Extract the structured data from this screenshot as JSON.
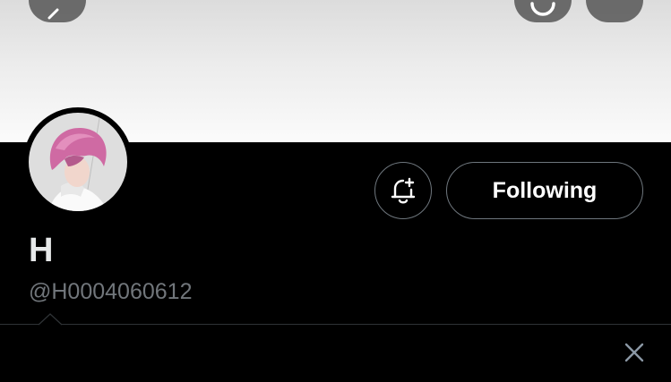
{
  "header": {
    "back_icon": "arrow-left-icon",
    "search_icon": "search-icon",
    "more_icon": "more-icon"
  },
  "profile": {
    "avatar_icon": "profile-photo",
    "display_name": "H",
    "handle": "@H0004060612",
    "notify_icon": "bell-plus-icon",
    "follow_label": "Following"
  },
  "tooltip": {
    "close_icon": "close-icon"
  },
  "colors": {
    "background": "#000000",
    "text_primary": "#e7e9ea",
    "text_secondary": "#71767b",
    "border": "#6e767d"
  }
}
